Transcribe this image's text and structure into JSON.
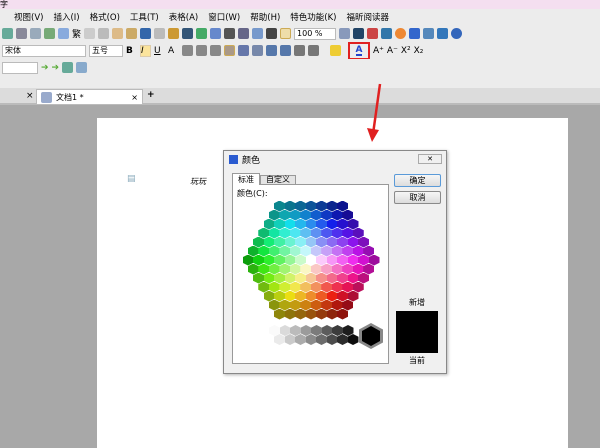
{
  "menu": [
    "视图(V)",
    "插入(I)",
    "格式(O)",
    "工具(T)",
    "表格(A)",
    "窗口(W)",
    "帮助(H)",
    "特色功能(K)",
    "福昕阅读器"
  ],
  "title_fragment": "字",
  "toolbar": {
    "zoom": "100 %",
    "font": "宋体",
    "size": "五号",
    "traditional": "繁"
  },
  "tabs": [
    {
      "label": "文档1 *"
    }
  ],
  "new_tab": "+",
  "document": {
    "text": "玩玩"
  },
  "dialog": {
    "title": "颜色",
    "tabs": [
      "标准",
      "自定义"
    ],
    "color_label": "颜色(C):",
    "ok": "确定",
    "cancel": "取消",
    "new_label": "新增",
    "current_label": "当前",
    "new_color": "#000000"
  },
  "accent": "#e02020"
}
